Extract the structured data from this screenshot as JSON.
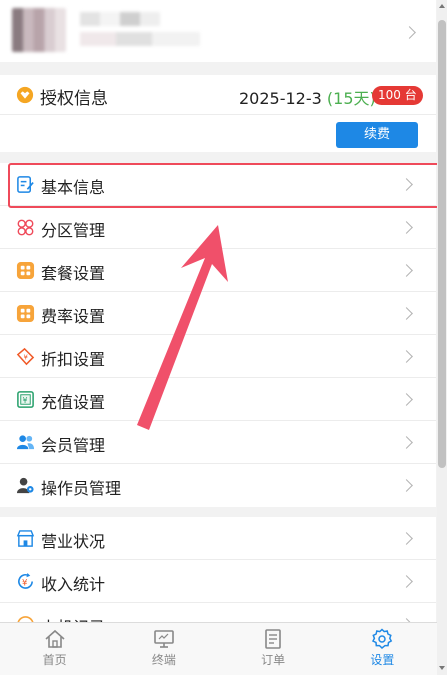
{
  "auth": {
    "title": "授权信息",
    "date": "2025-12-3",
    "days": "(15天)",
    "badge": "100 台",
    "renew_label": "续费"
  },
  "menu_group1": [
    {
      "name": "basic-info",
      "label": "基本信息",
      "icon": "edit-doc-icon"
    },
    {
      "name": "zone-manage",
      "label": "分区管理",
      "icon": "grid-petal-icon"
    },
    {
      "name": "package-settings",
      "label": "套餐设置",
      "icon": "apps-square-icon"
    },
    {
      "name": "rate-settings",
      "label": "费率设置",
      "icon": "apps-square-icon"
    },
    {
      "name": "discount-settings",
      "label": "折扣设置",
      "icon": "coupon-icon"
    },
    {
      "name": "recharge-settings",
      "label": "充值设置",
      "icon": "yuan-card-icon"
    },
    {
      "name": "member-manage",
      "label": "会员管理",
      "icon": "users-icon"
    },
    {
      "name": "operator-manage",
      "label": "操作员管理",
      "icon": "user-gear-icon"
    }
  ],
  "menu_group2": [
    {
      "name": "business-status",
      "label": "营业状况",
      "icon": "store-icon"
    },
    {
      "name": "income-stats",
      "label": "收入统计",
      "icon": "yuan-refresh-icon"
    },
    {
      "name": "up-machine-records",
      "label": "上机记录",
      "icon": "record-icon"
    }
  ],
  "tabs": [
    {
      "name": "home",
      "label": "首页",
      "icon": "home-icon",
      "active": false
    },
    {
      "name": "terminal",
      "label": "终端",
      "icon": "monitor-icon",
      "active": false
    },
    {
      "name": "orders",
      "label": "订单",
      "icon": "document-icon",
      "active": false
    },
    {
      "name": "settings",
      "label": "设置",
      "icon": "gear-icon",
      "active": true
    }
  ],
  "colors": {
    "accent": "#1e88e5",
    "highlight": "#ef4a5a",
    "days": "#4caf50",
    "badge": "#e53935"
  }
}
